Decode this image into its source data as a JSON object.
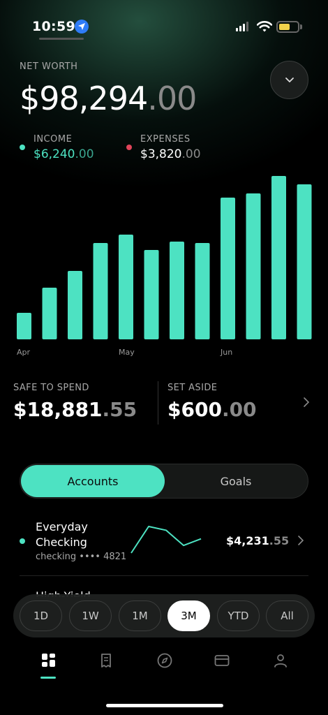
{
  "status": {
    "time": "10:59"
  },
  "net_worth": {
    "label": "NET WORTH",
    "dollars": "$98,294",
    "cents": ".00"
  },
  "income": {
    "label": "INCOME",
    "dollars": "$6,240",
    "cents": ".00"
  },
  "expenses": {
    "label": "EXPENSES",
    "dollars": "$3,820",
    "cents": ".00"
  },
  "chart_data": {
    "type": "bar",
    "values": [
      38,
      74,
      98,
      138,
      150,
      128,
      140,
      138,
      203,
      209,
      234,
      222
    ],
    "month_labels": [
      {
        "label": "Apr",
        "index": 0
      },
      {
        "label": "May",
        "index": 4
      },
      {
        "label": "Jun",
        "index": 8
      }
    ],
    "color": "#4de2c2"
  },
  "safe_to_spend": {
    "label": "SAFE TO SPEND",
    "dollars": "$18,881",
    "cents": ".55"
  },
  "set_aside": {
    "label": "SET ASIDE",
    "dollars": "$600",
    "cents": ".00"
  },
  "segments": {
    "accounts": "Accounts",
    "goals": "Goals"
  },
  "account": {
    "name": "Everyday Checking",
    "sub": "checking •••• 4821",
    "dollars": "$4,231",
    "cents": ".55",
    "sparkline": [
      10,
      38,
      34,
      18,
      25
    ]
  },
  "next_account_partial": "High-Yield",
  "ranges": [
    "1D",
    "1W",
    "1M",
    "3M",
    "YTD",
    "All"
  ],
  "active_range": "3M",
  "tabs": [
    "dashboard-icon",
    "receipt-icon",
    "compass-icon",
    "card-icon",
    "profile-icon"
  ],
  "colors": {
    "accent": "#4de2c2",
    "expense": "#e0445a"
  }
}
